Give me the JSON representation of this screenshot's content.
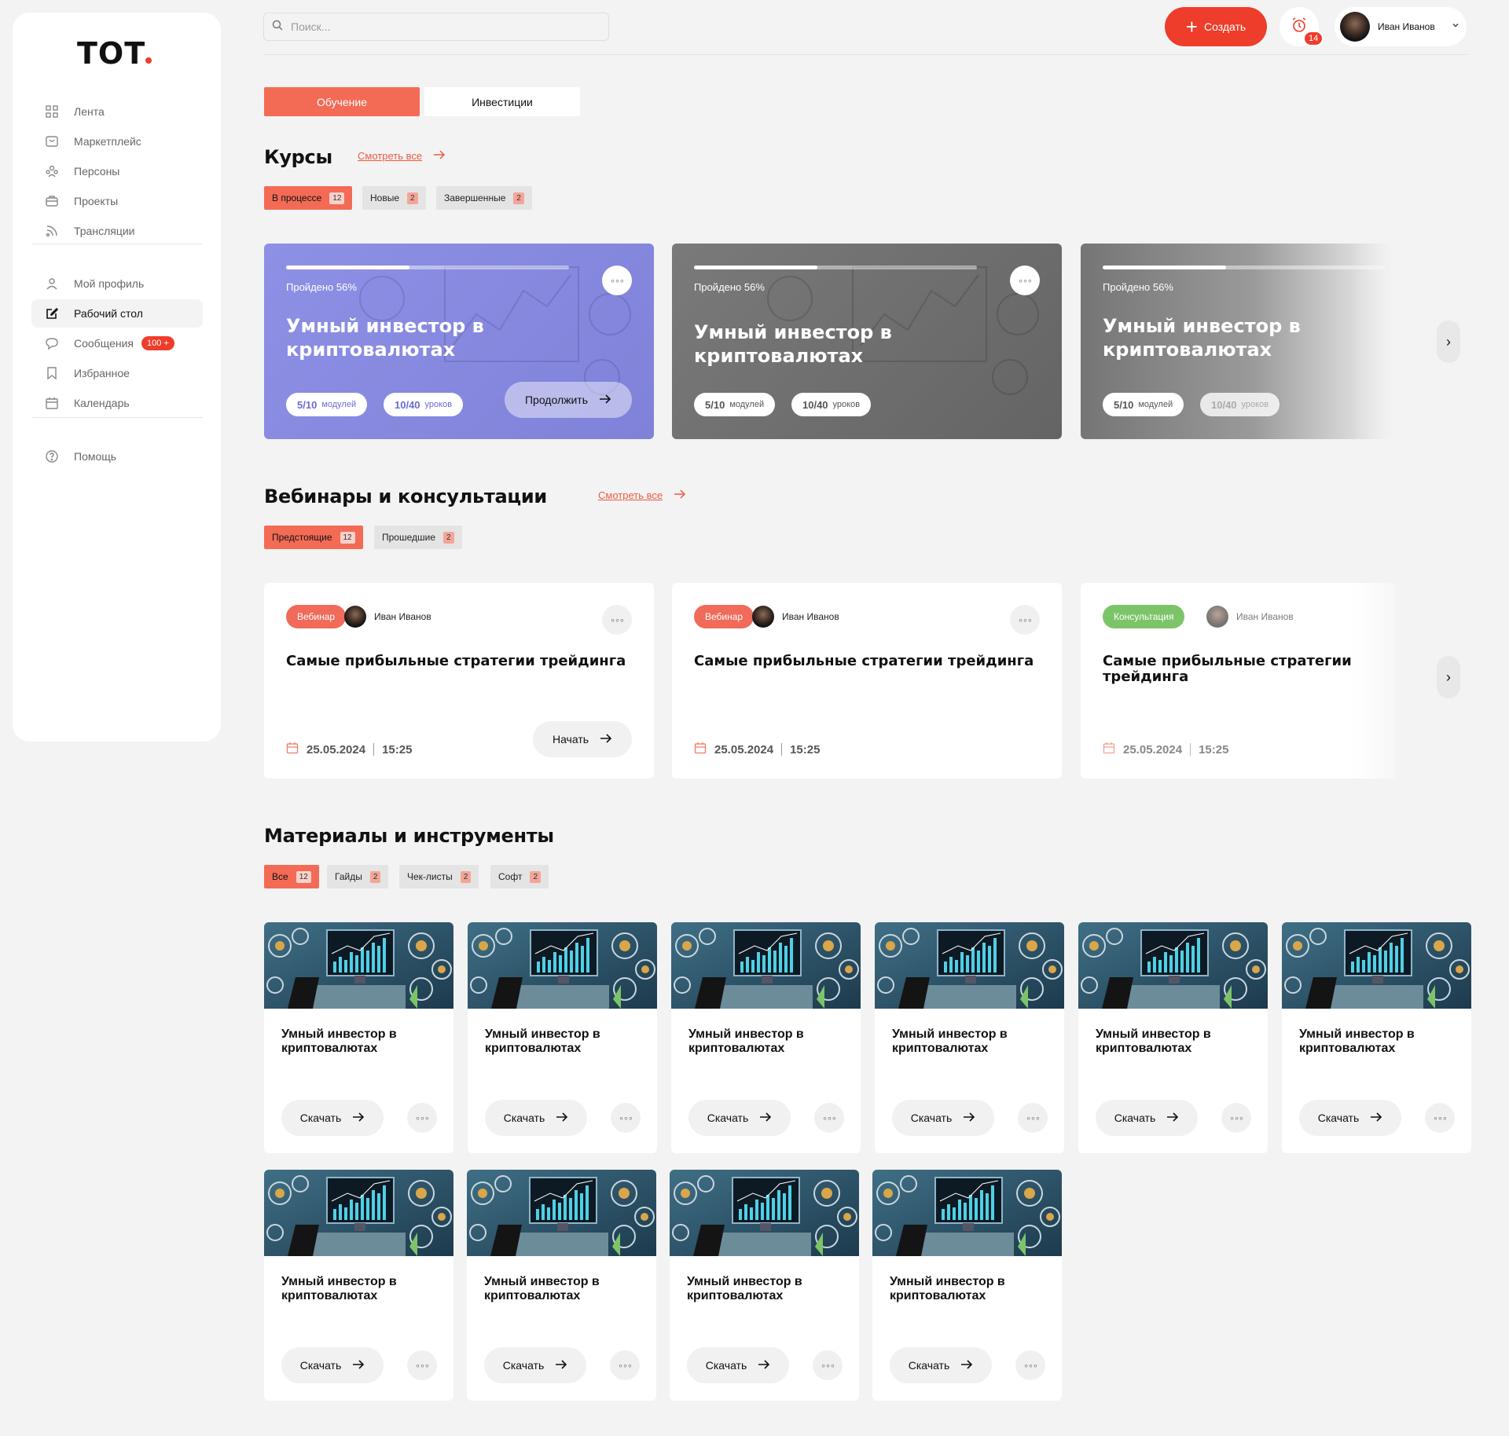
{
  "logo": {
    "text": "TOT"
  },
  "sidebar": {
    "items": [
      {
        "label": "Лента",
        "icon": "grid-icon"
      },
      {
        "label": "Маркетплейс",
        "icon": "shop-icon"
      },
      {
        "label": "Персоны",
        "icon": "people-icon"
      },
      {
        "label": "Проекты",
        "icon": "briefcase-icon"
      },
      {
        "label": "Трансляции",
        "icon": "broadcast-icon"
      },
      {
        "label": "Мой профиль",
        "icon": "user-icon"
      },
      {
        "label": "Рабочий стол",
        "icon": "edit-icon",
        "active": true
      },
      {
        "label": "Сообщения",
        "icon": "chat-icon",
        "badge": "100 +"
      },
      {
        "label": "Избранное",
        "icon": "bookmark-icon"
      },
      {
        "label": "Календарь",
        "icon": "calendar-icon"
      },
      {
        "label": "Помощь",
        "icon": "help-icon"
      }
    ]
  },
  "header": {
    "search_placeholder": "Поиск...",
    "create_label": "Создать",
    "notifications_count": "14",
    "user_name": "Иван Иванов"
  },
  "tabs": [
    {
      "label": "Обучение",
      "active": true
    },
    {
      "label": "Инвестиции",
      "active": false
    }
  ],
  "courses": {
    "title": "Курсы",
    "see_all": "Смотреть все",
    "filters": [
      {
        "label": "В процессе",
        "count": "12",
        "active": true
      },
      {
        "label": "Новые",
        "count": "2"
      },
      {
        "label": "Завершенные",
        "count": "2"
      }
    ],
    "cards": [
      {
        "progress_text": "Пройдено 56%",
        "progress": 0.56,
        "title": "Умный инвестор в криптовалютах",
        "modules_value": "5/10",
        "modules_label": "модулей",
        "lessons_value": "10/40",
        "lessons_label": "уроков",
        "action": "Продолжить"
      },
      {
        "progress_text": "Пройдено 56%",
        "progress": 0.56,
        "title": "Умный инвестор в криптовалютах",
        "modules_value": "5/10",
        "modules_label": "модулей",
        "lessons_value": "10/40",
        "lessons_label": "уроков"
      },
      {
        "progress_text": "Пройдено 56%",
        "progress": 0.56,
        "title": "Умный инвестор в криптовалютах",
        "modules_value": "5/10",
        "modules_label": "модулей",
        "lessons_value": "10/40",
        "lessons_label": "уроков"
      }
    ]
  },
  "webinars": {
    "title": "Вебинары и консультации",
    "see_all": "Смотреть все",
    "filters": [
      {
        "label": "Предстоящие",
        "count": "12",
        "active": true
      },
      {
        "label": "Прошедшие",
        "count": "2"
      }
    ],
    "cards": [
      {
        "tag": "Вебинар",
        "author": "Иван Иванов",
        "title": "Самые прибыльные стратегии трейдинга",
        "date": "25.05.2024",
        "time": "15:25",
        "action": "Начать"
      },
      {
        "tag": "Вебинар",
        "author": "Иван Иванов",
        "title": "Самые прибыльные стратегии трейдинга",
        "date": "25.05.2024",
        "time": "15:25"
      },
      {
        "tag": "Консультация",
        "author": "Иван Иванов",
        "title": "Самые прибыльные стратегии трейдинга",
        "date": "25.05.2024",
        "time": "15:25"
      }
    ]
  },
  "materials": {
    "title": "Материалы и инструменты",
    "filters": [
      {
        "label": "Все",
        "count": "12",
        "active": true
      },
      {
        "label": "Гайды",
        "count": "2"
      },
      {
        "label": "Чек-листы",
        "count": "2"
      },
      {
        "label": "Софт",
        "count": "2"
      }
    ],
    "cards": [
      {
        "title": "Умный инвестор в криптовалютах",
        "action": "Скачать"
      },
      {
        "title": "Умный инвестор в криптовалютах",
        "action": "Скачать"
      },
      {
        "title": "Умный инвестор в криптовалютах",
        "action": "Скачать"
      },
      {
        "title": "Умный инвестор в криптовалютах",
        "action": "Скачать"
      },
      {
        "title": "Умный инвестор в криптовалютах",
        "action": "Скачать"
      },
      {
        "title": "Умный инвестор в криптовалютах",
        "action": "Скачать"
      },
      {
        "title": "Умный инвестор в криптовалютах",
        "action": "Скачать"
      },
      {
        "title": "Умный инвестор в криптовалютах",
        "action": "Скачать"
      },
      {
        "title": "Умный инвестор в криптовалютах",
        "action": "Скачать"
      },
      {
        "title": "Умный инвестор в криптовалютах",
        "action": "Скачать"
      }
    ]
  },
  "colors": {
    "accent": "#ee3d2b",
    "tab_active": "#f36b55",
    "card_purple": "#8b8ddf",
    "card_gray": "#6e6e6e",
    "tag_webinar": "#f06b5a",
    "tag_consult": "#7cc468"
  }
}
